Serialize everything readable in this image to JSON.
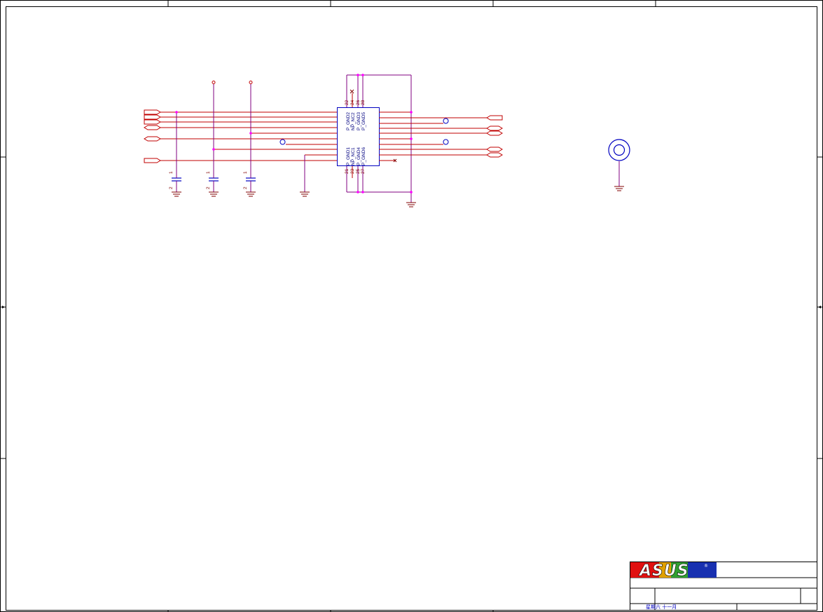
{
  "schematic": {
    "ic": {
      "top_pins": [
        "P_GND2",
        "NP_NC2",
        "P_GND3",
        "P_GND5"
      ],
      "top_pin_numbers": [
        "22",
        "24",
        "26",
        "28"
      ],
      "bottom_pins": [
        "P_GND1",
        "NP_NC1",
        "P_GND4",
        "P_GND6"
      ],
      "bottom_pin_numbers": [
        "21",
        "23",
        "25",
        "27"
      ]
    },
    "capacitors": [
      {
        "pin1": "1",
        "pin2": "2"
      },
      {
        "pin1": "1",
        "pin2": "2"
      },
      {
        "pin1": "1",
        "pin2": "2"
      }
    ]
  },
  "title_block": {
    "logo_text": "ASUS",
    "registered_mark": "®",
    "date_text": "星期六 十一月"
  },
  "colors": {
    "wire": "#c00000",
    "net": "#800080",
    "component": "#0000c0",
    "junction": "#ff00ff"
  }
}
